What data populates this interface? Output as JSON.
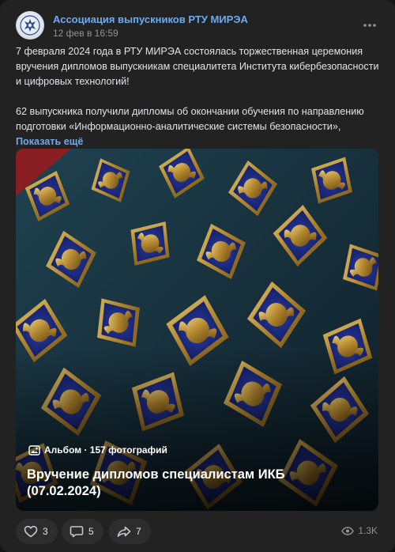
{
  "post": {
    "group_name": "Ассоциация выпускников РТУ МИРЭА",
    "date": "12 фев в 16:59",
    "paragraph1": "7 февраля 2024 года в РТУ МИРЭА состоялась торжественная церемония вручения дипломов выпускникам специалитета Института кибербезопасности и цифровых технологий!",
    "paragraph2": "62 выпускника получили дипломы об окончании обучения по направлению подготовки «Информационно-аналитические системы безопасности»,",
    "show_more": "Показать ещё"
  },
  "album": {
    "info": "Альбом · 157 фотографий",
    "title": "Вручение дипломов специалистам ИКБ (07.02.2024)"
  },
  "actions": {
    "likes": "3",
    "comments": "5",
    "shares": "7",
    "views": "1.3K"
  },
  "colors": {
    "accent": "#71aaeb",
    "card_bg": "#222222",
    "button_bg": "#2d2d2d",
    "badge_blue": "#1d2a7a",
    "badge_gold": "#c9a23a"
  },
  "icons": {
    "avatar": "university-emblem-icon",
    "more": "more-dots-icon",
    "album": "album-icon",
    "like": "heart-icon",
    "comment": "comment-icon",
    "share": "share-icon",
    "views": "eye-icon"
  }
}
